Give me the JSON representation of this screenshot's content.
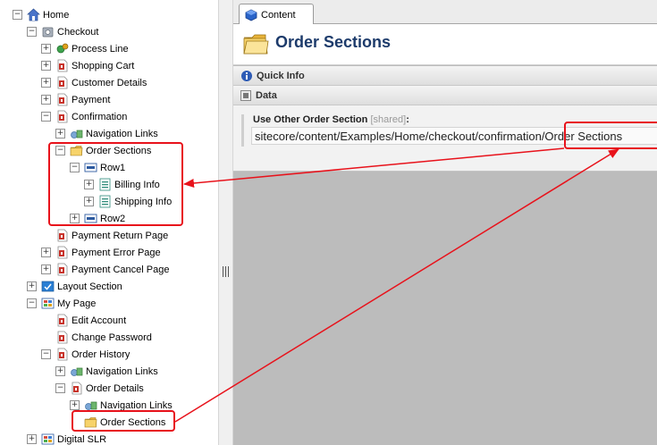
{
  "tree": {
    "items": [
      {
        "label": "Home",
        "icon": "home-icon",
        "toggle": "−"
      },
      {
        "label": "Checkout",
        "icon": "gear-box-icon",
        "toggle": "−"
      },
      {
        "label": "Process Line",
        "icon": "process-gear-icon",
        "toggle": "+"
      },
      {
        "label": "Shopping Cart",
        "icon": "document-icon",
        "toggle": "+"
      },
      {
        "label": "Customer Details",
        "icon": "document-icon",
        "toggle": "+"
      },
      {
        "label": "Payment",
        "icon": "document-icon",
        "toggle": "+"
      },
      {
        "label": "Confirmation",
        "icon": "document-icon",
        "toggle": "−"
      },
      {
        "label": "Navigation Links",
        "icon": "navigation-links-icon",
        "toggle": "+"
      },
      {
        "label": "Order Sections",
        "icon": "folder-icon",
        "toggle": "−"
      },
      {
        "label": "Row1",
        "icon": "row-icon",
        "toggle": "−"
      },
      {
        "label": "Billing Info",
        "icon": "form-icon",
        "toggle": "+"
      },
      {
        "label": "Shipping Info",
        "icon": "form-icon",
        "toggle": "+"
      },
      {
        "label": "Row2",
        "icon": "row-icon",
        "toggle": "+"
      },
      {
        "label": "Payment Return Page",
        "icon": "document-icon",
        "toggle": ""
      },
      {
        "label": "Payment Error Page",
        "icon": "document-icon",
        "toggle": "+"
      },
      {
        "label": "Payment Cancel Page",
        "icon": "document-icon",
        "toggle": "+"
      },
      {
        "label": "Layout Section",
        "icon": "layout-section-icon",
        "toggle": "+"
      },
      {
        "label": "My Page",
        "icon": "grid-page-icon",
        "toggle": "−"
      },
      {
        "label": "Edit Account",
        "icon": "document-icon",
        "toggle": ""
      },
      {
        "label": "Change Password",
        "icon": "document-icon",
        "toggle": ""
      },
      {
        "label": "Order History",
        "icon": "document-icon",
        "toggle": "−"
      },
      {
        "label": "Navigation Links",
        "icon": "navigation-links-icon",
        "toggle": "+"
      },
      {
        "label": "Order Details",
        "icon": "document-icon",
        "toggle": "−"
      },
      {
        "label": "Navigation Links",
        "icon": "navigation-links-icon",
        "toggle": "+"
      },
      {
        "label": "Order Sections",
        "icon": "folder-icon",
        "toggle": ""
      },
      {
        "label": "Digital SLR",
        "icon": "grid-page-icon",
        "toggle": "+"
      }
    ]
  },
  "content": {
    "tab_label": "Content",
    "title": "Order Sections",
    "quick_info_label": "Quick Info",
    "data_label": "Data",
    "field": {
      "label": "Use Other Order Section",
      "shared": "[shared]",
      "colon": ":",
      "value": "sitecore/content/Examples/Home/checkout/confirmation/Order Sections"
    }
  },
  "colors": {
    "callout": "#e8121b",
    "title": "#1d3b6b",
    "folder": "#f2c94c"
  }
}
